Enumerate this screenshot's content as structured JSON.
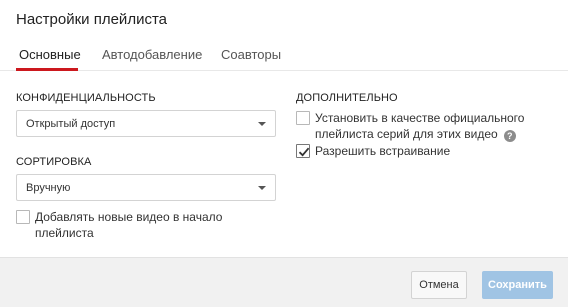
{
  "dialog": {
    "title": "Настройки плейлиста"
  },
  "tabs": [
    {
      "label": "Основные",
      "active": true
    },
    {
      "label": "Автодобавление",
      "active": false
    },
    {
      "label": "Соавторы",
      "active": false
    }
  ],
  "privacy": {
    "label": "КОНФИДЕНЦИАЛЬНОСТЬ",
    "selected": "Открытый доступ"
  },
  "sorting": {
    "label": "СОРТИРОВКА",
    "selected": "Вручную"
  },
  "add_to_top": {
    "label_line1": "Добавлять новые видео в начало",
    "label_line2": "плейлиста",
    "checked": false
  },
  "advanced": {
    "label": "ДОПОЛНИТЕЛЬНО",
    "official_series": {
      "label_line1": "Установить в качестве официального",
      "label_line2": "плейлиста серий для этих видео",
      "help_icon": "help-icon",
      "checked": false
    },
    "allow_embed": {
      "label": "Разрешить встраивание",
      "checked": true
    }
  },
  "footer": {
    "cancel_label": "Отмена",
    "save_label": "Сохранить"
  },
  "colors": {
    "accent_red": "#cc181e",
    "save_disabled": "#a0c4e4"
  }
}
